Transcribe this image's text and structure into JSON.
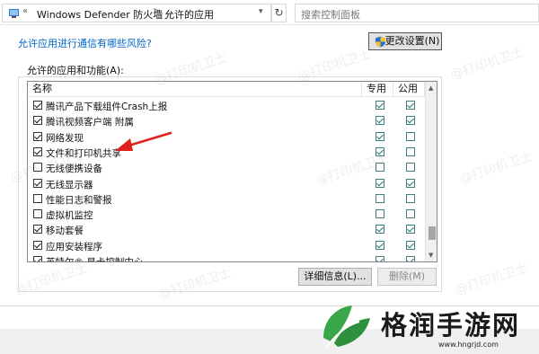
{
  "address_bar": {
    "chevrons": "«",
    "crumbs": [
      "Windows Defender 防火墙",
      "允许的应用"
    ],
    "separator": ">",
    "search_placeholder": "搜索控制面板"
  },
  "header": {
    "risk_link": "允许应用进行通信有哪些风险?",
    "change_settings_label": "更改设置(N)"
  },
  "group": {
    "label": "允许的应用和功能(A):",
    "columns": [
      "名称",
      "专用",
      "公用"
    ],
    "rows": [
      {
        "name": "腾讯产品下载组件Crash上报",
        "enabled": true,
        "private": true,
        "public": true
      },
      {
        "name": "腾讯视频客户端 附属",
        "enabled": true,
        "private": true,
        "public": true
      },
      {
        "name": "网络发现",
        "enabled": true,
        "private": true,
        "public": false
      },
      {
        "name": "文件和打印机共享",
        "enabled": true,
        "private": true,
        "public": false
      },
      {
        "name": "无线便携设备",
        "enabled": false,
        "private": false,
        "public": false
      },
      {
        "name": "无线显示器",
        "enabled": true,
        "private": true,
        "public": true
      },
      {
        "name": "性能日志和警报",
        "enabled": false,
        "private": false,
        "public": false
      },
      {
        "name": "虚拟机监控",
        "enabled": false,
        "private": false,
        "public": false
      },
      {
        "name": "移动套餐",
        "enabled": true,
        "private": true,
        "public": true
      },
      {
        "name": "应用安装程序",
        "enabled": true,
        "private": true,
        "public": true
      },
      {
        "name": "英特尔® 显卡控制中心",
        "enabled": true,
        "private": true,
        "public": true
      }
    ],
    "details_button": "详细信息(L)...",
    "delete_button": "删除(M)"
  },
  "watermark_text": "@打印机卫士",
  "logo": {
    "text": "格润手游网",
    "url": "www.hngrjd.com"
  },
  "colors": {
    "link": "#0066cc",
    "arrow": "#e0211b",
    "logo_green": "#3aa64a"
  }
}
